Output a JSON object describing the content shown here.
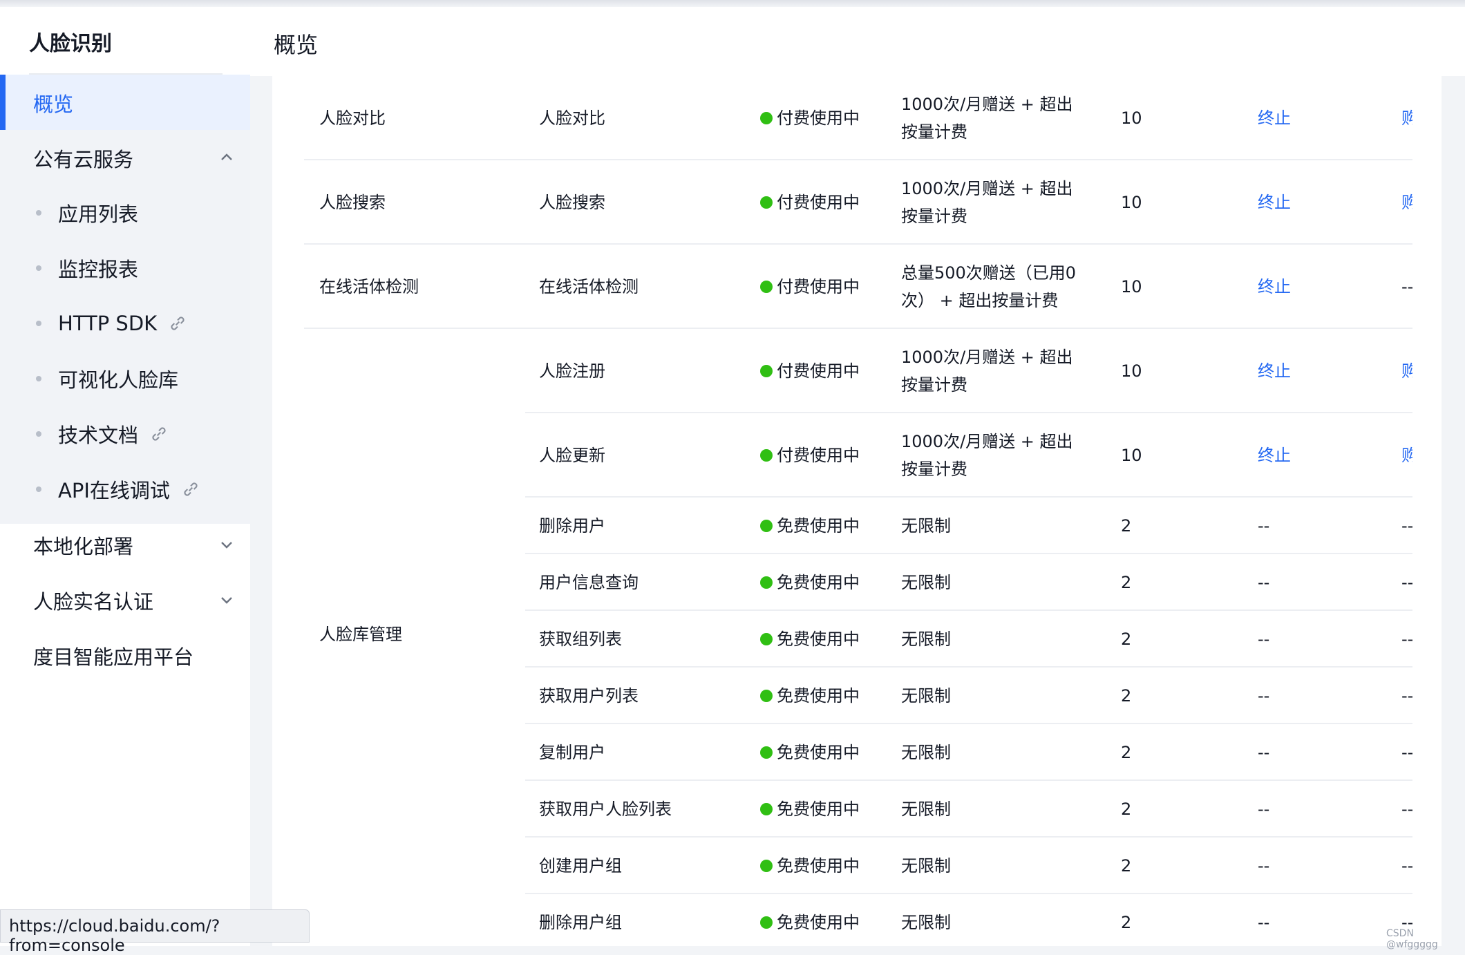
{
  "sidebar": {
    "title": "人脸识别",
    "active_label": "概览",
    "groups": [
      {
        "label": "公有云服务",
        "expanded": true
      },
      {
        "label": "本地化部署",
        "expanded": false
      },
      {
        "label": "人脸实名认证",
        "expanded": false
      },
      {
        "label": "度目智能应用平台"
      }
    ],
    "sub_items": [
      {
        "label": "应用列表",
        "external": false
      },
      {
        "label": "监控报表",
        "external": false
      },
      {
        "label": "HTTP SDK",
        "external": true
      },
      {
        "label": "可视化人脸库",
        "external": false
      },
      {
        "label": "技术文档",
        "external": true
      },
      {
        "label": "API在线调试",
        "external": true
      }
    ]
  },
  "header": {
    "title": "概览"
  },
  "table": {
    "rows": [
      {
        "category": "人脸对比",
        "name": "人脸对比",
        "status": "付费使用中",
        "quota": "1000次/月赠送 + 超出按量计费",
        "qps": "10",
        "action": "终止",
        "buy": "购"
      },
      {
        "category": "人脸搜索",
        "name": "人脸搜索",
        "status": "付费使用中",
        "quota": "1000次/月赠送 + 超出按量计费",
        "qps": "10",
        "action": "终止",
        "buy": "购"
      },
      {
        "category": "在线活体检测",
        "name": "在线活体检测",
        "status": "付费使用中",
        "quota": "总量500次赠送（已用0次） + 超出按量计费",
        "qps": "10",
        "action": "终止",
        "buy": "--"
      },
      {
        "category": "",
        "name": "人脸注册",
        "status": "付费使用中",
        "quota": "1000次/月赠送 + 超出按量计费",
        "qps": "10",
        "action": "终止",
        "buy": "购"
      },
      {
        "category": "",
        "name": "人脸更新",
        "status": "付费使用中",
        "quota": "1000次/月赠送 + 超出按量计费",
        "qps": "10",
        "action": "终止",
        "buy": "购"
      },
      {
        "category": "",
        "name": "删除用户",
        "status": "免费使用中",
        "quota": "无限制",
        "qps": "2",
        "action": "--",
        "buy": "--"
      },
      {
        "category": "",
        "name": "用户信息查询",
        "status": "免费使用中",
        "quota": "无限制",
        "qps": "2",
        "action": "--",
        "buy": "--"
      },
      {
        "category": "",
        "name": "获取组列表",
        "status": "免费使用中",
        "quota": "无限制",
        "qps": "2",
        "action": "--",
        "buy": "--"
      },
      {
        "category": "",
        "name": "获取用户列表",
        "status": "免费使用中",
        "quota": "无限制",
        "qps": "2",
        "action": "--",
        "buy": "--"
      },
      {
        "category": "",
        "name": "复制用户",
        "status": "免费使用中",
        "quota": "无限制",
        "qps": "2",
        "action": "--",
        "buy": "--"
      },
      {
        "category": "",
        "name": "获取用户人脸列表",
        "status": "免费使用中",
        "quota": "无限制",
        "qps": "2",
        "action": "--",
        "buy": "--"
      },
      {
        "category": "",
        "name": "创建用户组",
        "status": "免费使用中",
        "quota": "无限制",
        "qps": "2",
        "action": "--",
        "buy": "--"
      },
      {
        "category": "",
        "name": "删除用户组",
        "status": "免费使用中",
        "quota": "无限制",
        "qps": "2",
        "action": "--",
        "buy": "--"
      }
    ],
    "group_label": "人脸库管理"
  },
  "status_bar": {
    "url": "https://cloud.baidu.com/?from=console"
  },
  "watermark": "CSDN @wfggggg",
  "colors": {
    "accent": "#2468f2",
    "status_green": "#30bf13",
    "active_bg": "#eaf1fe"
  },
  "icons": {
    "chevron_up": "chevron-up-icon",
    "chevron_down": "chevron-down-icon",
    "external": "link-icon"
  }
}
